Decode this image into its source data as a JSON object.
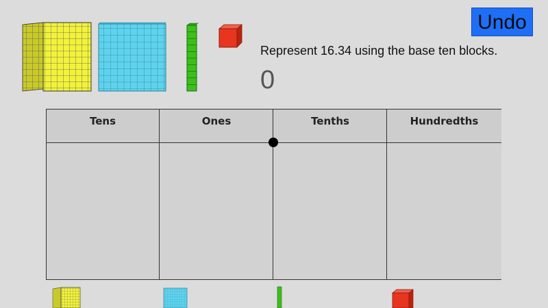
{
  "toolbar": {
    "undo_label": "Undo"
  },
  "prompt": {
    "text": "Represent 16.34 using the base ten blocks."
  },
  "current_value": "0",
  "table": {
    "headers": [
      "Tens",
      "Ones",
      "Tenths",
      "Hundredths"
    ]
  },
  "colors": {
    "thousand_cube": "#f2f23a",
    "hundred_flat": "#5fd3ee",
    "ten_rod": "#3cbf1a",
    "unit_cube": "#e8351f",
    "undo_button": "#1e6ff5"
  },
  "blocks": {
    "top_palette": [
      "thousand-cube-icon",
      "hundred-flat-icon",
      "ten-rod-icon",
      "unit-cube-icon"
    ],
    "bottom_tray": [
      "thousand-cube-icon",
      "hundred-flat-icon",
      "ten-rod-icon",
      "unit-cube-icon"
    ]
  }
}
